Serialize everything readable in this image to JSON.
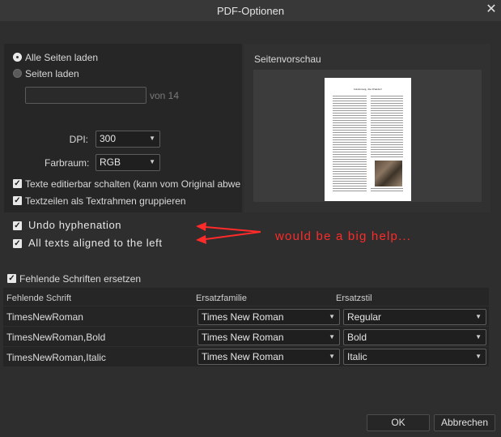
{
  "dialog": {
    "title": "PDF-Optionen",
    "close_glyph": "✕"
  },
  "pages": {
    "option_all": "Alle Seiten laden",
    "option_range": "Seiten laden",
    "range_value": "",
    "of_label": "von 14"
  },
  "render": {
    "dpi_label": "DPI:",
    "dpi_value": "300",
    "colorspace_label": "Farbraum:",
    "colorspace_value": "RGB"
  },
  "options": {
    "editable_text": "Texte editierbar schalten (kann vom Original abweicher",
    "group_lines": "Textzeilen als Textrahmen gruppieren"
  },
  "preview": {
    "label": "Seitenvorschau",
    "page_heading": "Jakobsweg, das Wunder!"
  },
  "suggestions": {
    "undo_hyphenation": "Undo hyphenation",
    "align_left": "All texts aligned to the left",
    "annotation": "would be a big help..."
  },
  "fonts": {
    "replace_missing": "Fehlende Schriften ersetzen",
    "columns": [
      "Fehlende Schrift",
      "Ersatzfamilie",
      "Ersatzstil"
    ],
    "rows": [
      {
        "missing": "TimesNewRoman",
        "family": "Times New Roman",
        "style": "Regular"
      },
      {
        "missing": "TimesNewRoman,Bold",
        "family": "Times New Roman",
        "style": "Bold"
      },
      {
        "missing": "TimesNewRoman,Italic",
        "family": "Times New Roman",
        "style": "Italic"
      }
    ]
  },
  "buttons": {
    "ok": "OK",
    "cancel": "Abbrechen"
  },
  "icons": {
    "checkbox": "checkmark-icon",
    "dropdown": "chevron-down-icon",
    "close": "close-icon"
  },
  "colors": {
    "annotation": "#ff2a2a",
    "background": "#2e2e2e"
  }
}
